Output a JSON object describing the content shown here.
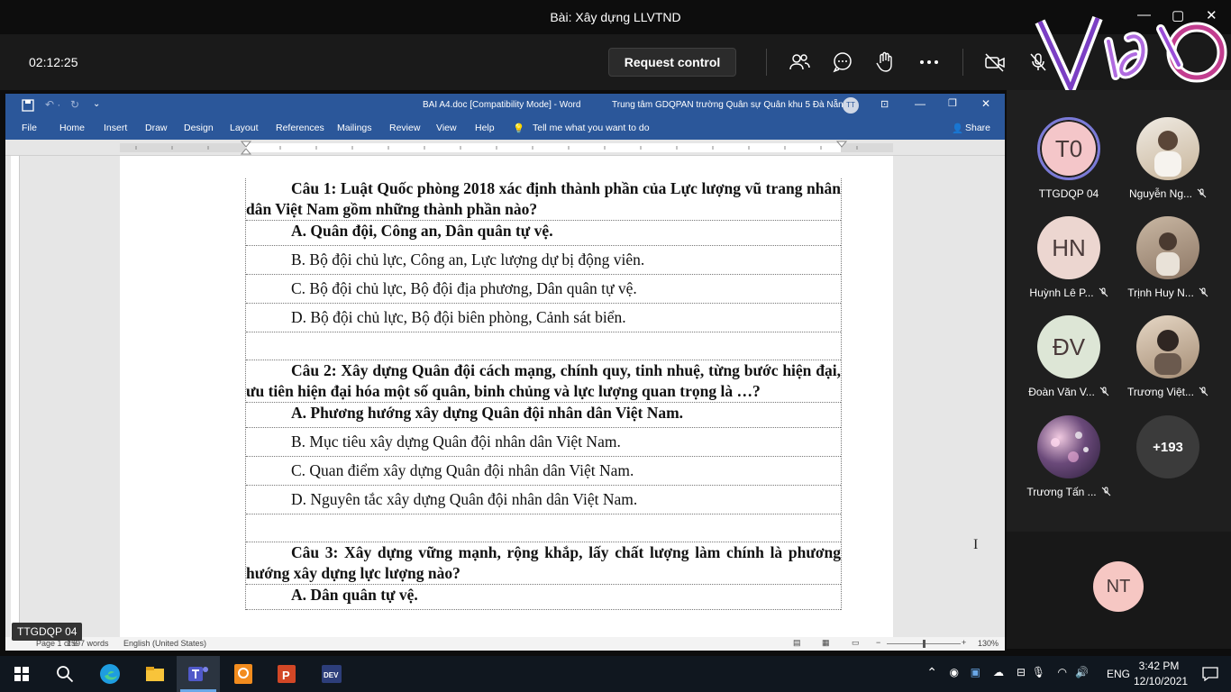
{
  "window": {
    "title": "Bài: Xây dựng LLVTND"
  },
  "meeting": {
    "timer": "02:12:25",
    "request_control": "Request control"
  },
  "word": {
    "doc_title": "BAI A4.doc [Compatibility Mode]  -  Word",
    "org": "Trung tâm GDQPAN trường Quân sự Quân khu 5 Đà Nẵng",
    "user_initials": "TT",
    "menu": [
      "File",
      "Home",
      "Insert",
      "Draw",
      "Design",
      "Layout",
      "References",
      "Mailings",
      "Review",
      "View",
      "Help"
    ],
    "tell_me": "Tell me what you want to do",
    "share": "Share",
    "status_page": "Page 1 of 6",
    "status_words": "1597 words",
    "status_lang": "English (United States)",
    "zoom": "130%"
  },
  "document": {
    "q1": "Câu 1: Luật Quốc phòng 2018 xác định thành phần của Lực lượng vũ trang nhân dân Việt Nam gồm những thành phần nào?",
    "q1a": "A. Quân đội, Công an, Dân quân tự vệ.",
    "q1b": "B. Bộ đội chủ lực, Công an, Lực lượng dự bị động viên.",
    "q1c": "C. Bộ đội chủ lực, Bộ đội địa phương, Dân quân tự vệ.",
    "q1d": "D. Bộ đội chủ lực, Bộ đội biên phòng, Cảnh sát biển.",
    "q2": "Câu 2: Xây dựng Quân đội cách mạng, chính quy, tinh nhuệ, từng bước hiện đại, ưu tiên hiện đại hóa một số quân, binh chủng và lực lượng quan trọng là …?",
    "q2a": "A. Phương hướng xây dựng Quân đội nhân dân Việt Nam.",
    "q2b": "B. Mục tiêu xây dựng Quân đội nhân dân Việt Nam.",
    "q2c": "C. Quan điểm xây dựng Quân đội nhân dân Việt Nam.",
    "q2d": "D. Nguyên tắc xây dựng Quân đội nhân dân Việt Nam.",
    "q3": "Câu 3: Xây dựng vững mạnh, rộng khắp, lấy chất lượng làm chính là phương hướng xây dựng lực lượng nào?",
    "q3a": "A. Dân quân tự vệ."
  },
  "presenter_label": "TTGDQP 04",
  "participants": [
    {
      "initials": "T0",
      "name": "TTGDQP 04",
      "muted": false,
      "color": "#f4c6c9"
    },
    {
      "initials": "",
      "name": "Nguyễn Ng...",
      "muted": true,
      "color": "#d9cbb6"
    },
    {
      "initials": "HN",
      "name": "Huỳnh Lê P...",
      "muted": true,
      "color": "#ecd6d0"
    },
    {
      "initials": "",
      "name": "Trịnh Huy N...",
      "muted": true,
      "color": "#b8a38f"
    },
    {
      "initials": "ĐV",
      "name": "Đoàn Văn V...",
      "muted": true,
      "color": "#dde6d6"
    },
    {
      "initials": "",
      "name": "Trương Việt...",
      "muted": true,
      "color": "#c9b8a6"
    },
    {
      "initials": "",
      "name": "Trương Tấn ...",
      "muted": true,
      "color": "#6b4a7a"
    },
    {
      "initials": "+193",
      "name": "",
      "muted": false,
      "color": "#3b3b3b"
    }
  ],
  "self_initials": "NT",
  "taskbar": {
    "lang": "ENG",
    "time": "3:42 PM",
    "date": "12/10/2021"
  }
}
